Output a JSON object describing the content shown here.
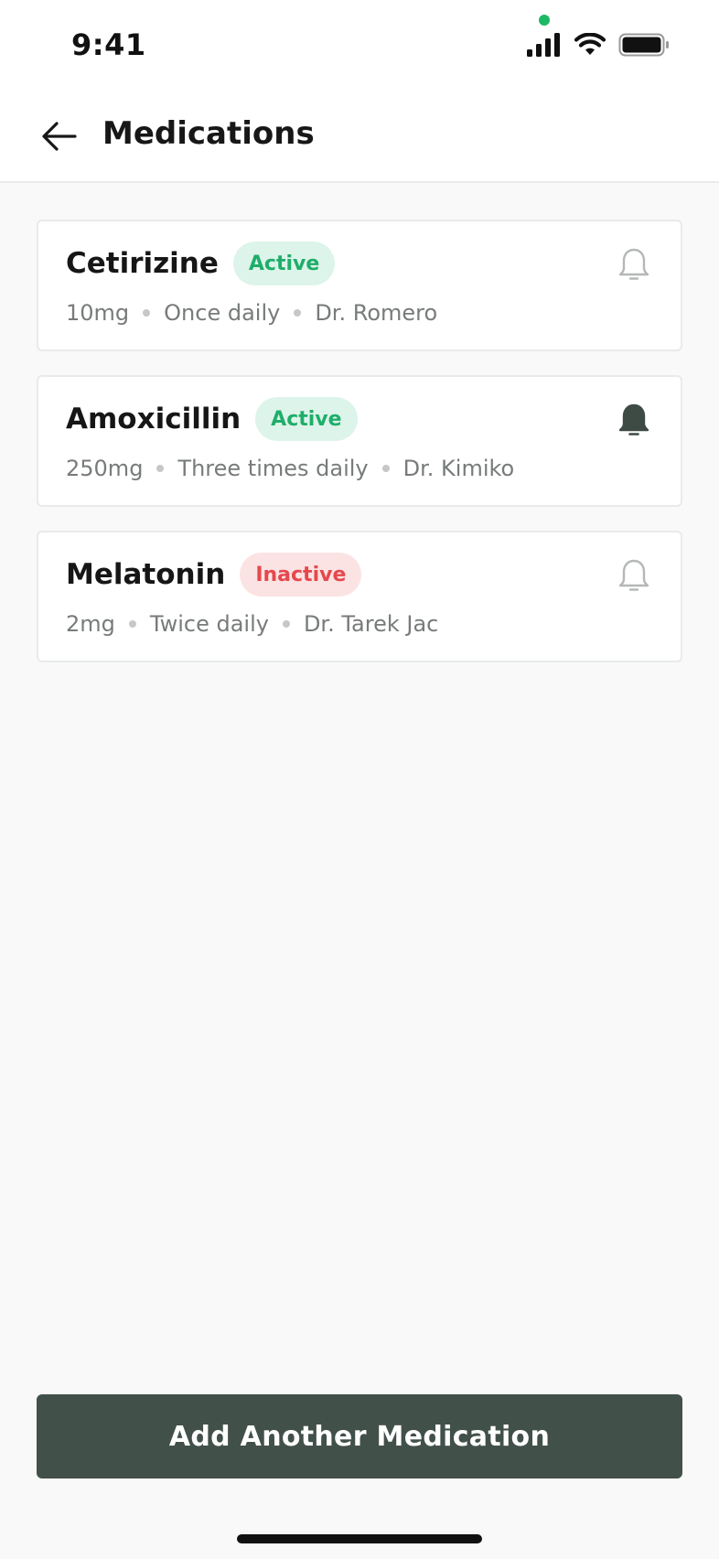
{
  "status_bar": {
    "time": "9:41",
    "icons": [
      "signal-icon",
      "wifi-icon",
      "battery-icon"
    ],
    "camera_dot_color": "#1DB866"
  },
  "header": {
    "back_icon": "arrow-left-icon",
    "title": "Medications"
  },
  "medications": [
    {
      "name": "Cetirizine",
      "status": "Active",
      "dose": "10mg",
      "frequency": "Once daily",
      "doctor": "Dr. Romero",
      "reminder_on": false
    },
    {
      "name": "Amoxicillin",
      "status": "Active",
      "dose": "250mg",
      "frequency": "Three times daily",
      "doctor": "Dr. Kimiko",
      "reminder_on": true
    },
    {
      "name": "Melatonin",
      "status": "Inactive",
      "dose": "2mg",
      "frequency": "Twice daily",
      "doctor": "Dr. Tarek Jac",
      "reminder_on": false
    }
  ],
  "add_button": {
    "label": "Add Another Medication"
  },
  "colors": {
    "primary": "#42504A",
    "active_text": "#1FAE6A",
    "active_bg": "#DDF4EA",
    "inactive_text": "#E5484D",
    "inactive_bg": "#FCE3E3",
    "bell_off": "#B4B8B6",
    "bell_on": "#3E4B45"
  }
}
